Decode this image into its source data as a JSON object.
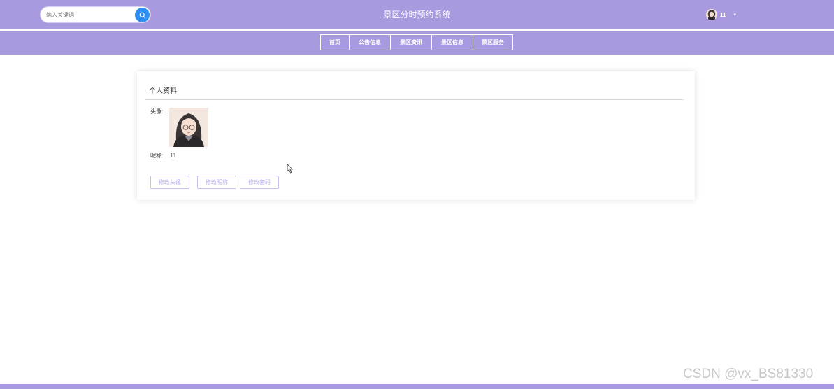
{
  "header": {
    "site_title": "景区分时预约系统",
    "search": {
      "placeholder": "输入关键词",
      "value": "",
      "icon": "search-icon"
    },
    "user": {
      "name": "11",
      "avatar": "avatar-girl-glasses",
      "dropdown_icon": "caret-down-icon"
    }
  },
  "nav": {
    "items": [
      {
        "label": "首页"
      },
      {
        "label": "公告信息"
      },
      {
        "label": "景区资讯"
      },
      {
        "label": "景区信息"
      },
      {
        "label": "景区服务"
      }
    ]
  },
  "profile": {
    "title": "个人资料",
    "avatar_label": "头像:",
    "avatar": "avatar-girl-glasses",
    "nickname_label": "昵称:",
    "nickname": "11",
    "buttons": {
      "change_avatar": "修改头像",
      "change_nickname": "修改昵称",
      "change_password": "修改密码"
    }
  },
  "watermark": "CSDN @vx_BS81330",
  "colors": {
    "brand": "#a99ae0",
    "search_button": "#2f8ef2",
    "button_text": "#b7adeb"
  }
}
